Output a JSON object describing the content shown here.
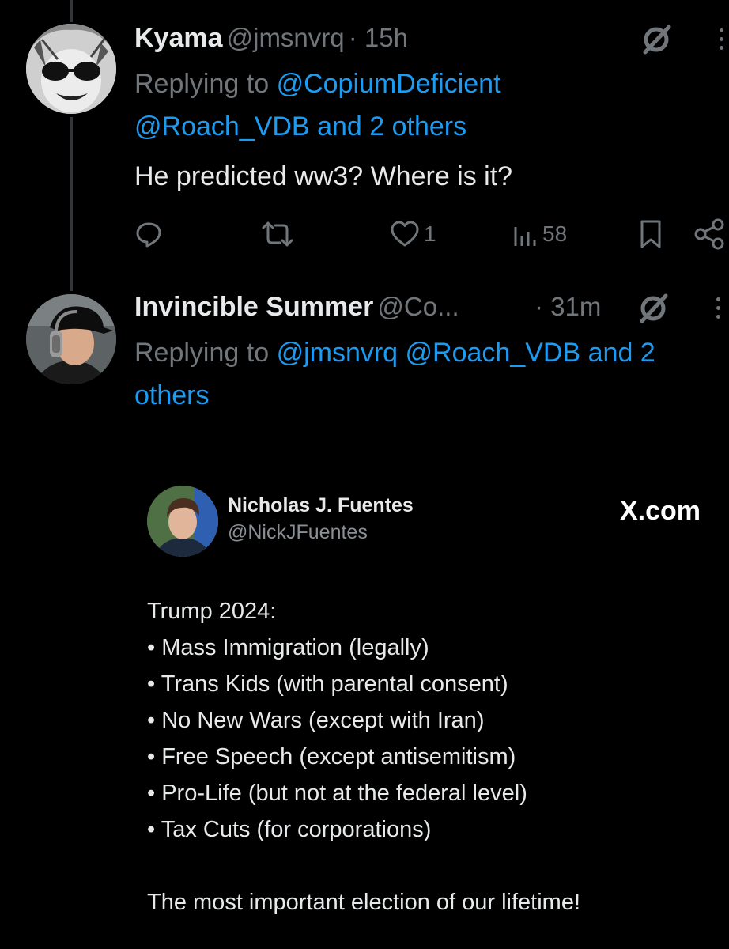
{
  "tweet1": {
    "name": "Kyama",
    "handle": "@jmsnvrq",
    "time": "· 15h",
    "replying_prefix": "Replying to",
    "replying_to_1": "@CopiumDeficient",
    "replying_to_2": "@Roach_VDB",
    "replying_suffix": "and 2 others",
    "text": "He predicted ww3? Where is it?",
    "likes": "1",
    "views": "58"
  },
  "tweet2": {
    "name": "Invincible Summer",
    "handle": "@Co...",
    "time": "· 31m",
    "replying_prefix": "Replying to",
    "replying_to_1": "@jmsnvrq",
    "replying_to_2": "@Roach_VDB",
    "replying_suffix_a": "and 2",
    "replying_suffix_b": "others"
  },
  "embed": {
    "name": "Nicholas J. Fuentes",
    "handle": "@NickJFuentes",
    "brand": "X.com",
    "heading": "Trump 2024:",
    "items": [
      "Mass Immigration (legally)",
      "Trans Kids (with parental consent)",
      "No New Wars (except with Iran)",
      "Free Speech (except antisemitism)",
      "Pro-Life (but not at the federal level)",
      "Tax Cuts (for corporations)"
    ],
    "closing": "The most important election of our lifetime!"
  },
  "colors": {
    "background": "#000000",
    "primary_text": "#e7e9ea",
    "secondary_text": "#71767b",
    "link": "#1d9bf0"
  },
  "icons": [
    "grok-slash-icon",
    "more-icon",
    "reply-icon",
    "retweet-icon",
    "like-icon",
    "views-icon",
    "bookmark-icon",
    "share-icon"
  ]
}
